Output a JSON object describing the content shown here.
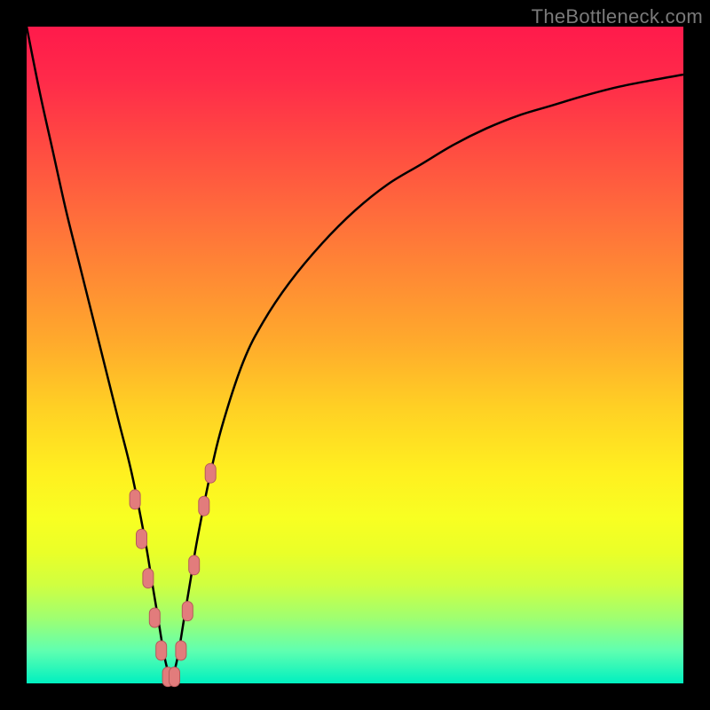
{
  "watermark": "TheBottleneck.com",
  "colors": {
    "curve": "#000000",
    "marker_fill": "#e27c7c",
    "marker_stroke": "#b55a5a",
    "gradient_top": "#ff1a4b",
    "gradient_bottom": "#00f0c0"
  },
  "chart_data": {
    "type": "line",
    "title": "",
    "xlabel": "",
    "ylabel": "",
    "xlim": [
      0,
      100
    ],
    "ylim": [
      0,
      100
    ],
    "grid": false,
    "legend": false,
    "minimum_x": 22,
    "series": [
      {
        "name": "bottleneck-curve",
        "x": [
          0,
          2,
          4,
          6,
          8,
          10,
          12,
          14,
          16,
          18,
          19,
          20,
          21,
          22,
          23,
          24,
          25,
          26,
          28,
          30,
          33,
          36,
          40,
          45,
          50,
          55,
          60,
          65,
          70,
          75,
          80,
          85,
          90,
          95,
          100
        ],
        "y": [
          100,
          90,
          81,
          72,
          64,
          56,
          48,
          40,
          32,
          22,
          16,
          10,
          4,
          0,
          4,
          10,
          16,
          22,
          32,
          40,
          49,
          55,
          61,
          67,
          72,
          76,
          79,
          82,
          84.5,
          86.5,
          88,
          89.5,
          90.8,
          91.8,
          92.7
        ]
      }
    ],
    "markers": [
      {
        "x": 16.5,
        "y": 28
      },
      {
        "x": 17.5,
        "y": 22
      },
      {
        "x": 18.5,
        "y": 16
      },
      {
        "x": 19.5,
        "y": 10
      },
      {
        "x": 20.5,
        "y": 5
      },
      {
        "x": 21.5,
        "y": 1
      },
      {
        "x": 22.5,
        "y": 1
      },
      {
        "x": 23.5,
        "y": 5
      },
      {
        "x": 24.5,
        "y": 11
      },
      {
        "x": 25.5,
        "y": 18
      },
      {
        "x": 27.0,
        "y": 27
      },
      {
        "x": 28.0,
        "y": 32
      }
    ],
    "marker_shape": "vertical-capsule"
  }
}
